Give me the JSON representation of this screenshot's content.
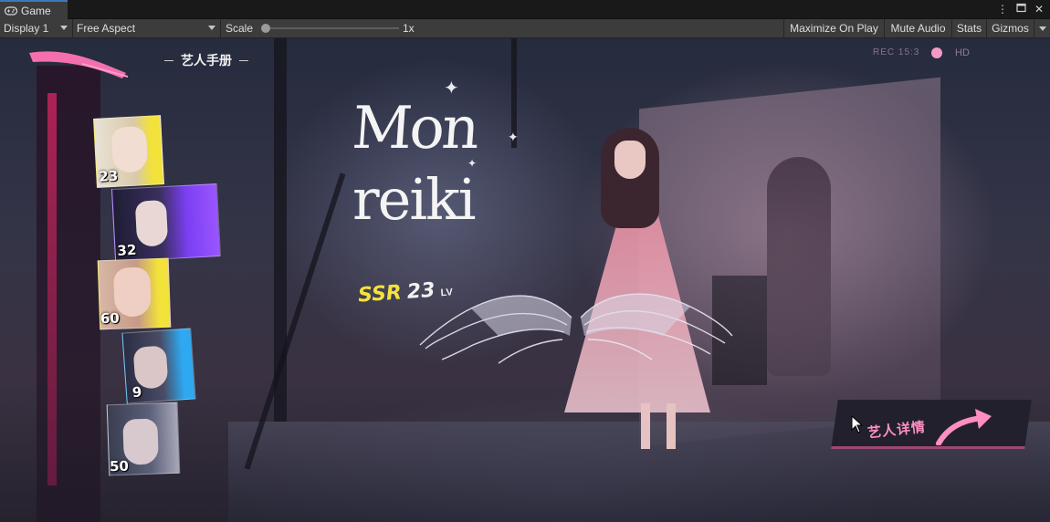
{
  "editor": {
    "tab_title": "Game",
    "display_select": "Display 1",
    "aspect_select": "Free Aspect",
    "scale_label": "Scale",
    "scale_value": "1x",
    "buttons": {
      "maximize": "Maximize On Play",
      "mute": "Mute Audio",
      "stats": "Stats",
      "gizmos": "Gizmos"
    },
    "icons": [
      "gamepad-icon",
      "kebab-menu-icon",
      "maximize-icon",
      "close-icon"
    ]
  },
  "game": {
    "handbook_title": "艺人手册",
    "rec_label": "REC 15:3",
    "hd_label": "HD",
    "rec_dot_color": "#f59ac4",
    "artist_name_line1": "Mon",
    "artist_name_line2": "reiki",
    "rarity": "SSR",
    "level": "23",
    "level_suffix": "LV",
    "detail_button": "艺人详情",
    "cards": [
      {
        "level": "23",
        "accent": "#f2e23a"
      },
      {
        "level": "32",
        "accent": "#7b3ff2"
      },
      {
        "level": "60",
        "accent": "#f2e23a"
      },
      {
        "level": "9",
        "accent": "#2ea8f0"
      },
      {
        "level": "50",
        "accent": "#3a3e52"
      }
    ],
    "colors": {
      "rarity": "#f4e23a",
      "accent_pink": "#ff8fc0",
      "strip_pink": "#c2255c"
    }
  }
}
